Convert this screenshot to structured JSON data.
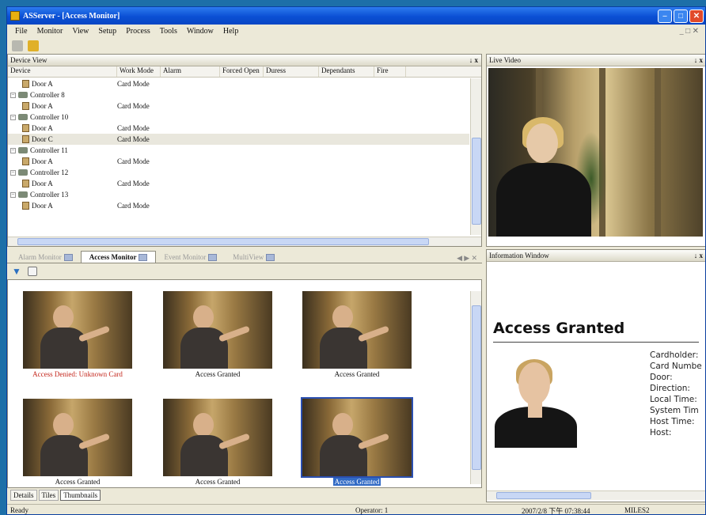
{
  "window": {
    "title": "ASServer - [Access Monitor]"
  },
  "menu": [
    "File",
    "Monitor",
    "View",
    "Setup",
    "Process",
    "Tools",
    "Window",
    "Help"
  ],
  "device_view": {
    "title": "Device View",
    "close": "x",
    "columns": [
      "Device",
      "Work Mode",
      "Alarm",
      "Forced Open",
      "Duress",
      "Dependants",
      "Fire"
    ],
    "rows": [
      {
        "name": "Door A",
        "mode": "Card Mode",
        "level": "door"
      },
      {
        "name": "Controller 8",
        "mode": "",
        "level": "controller"
      },
      {
        "name": "Door A",
        "mode": "Card Mode",
        "level": "door"
      },
      {
        "name": "Controller 10",
        "mode": "",
        "level": "controller"
      },
      {
        "name": "Door A",
        "mode": "Card Mode",
        "level": "door"
      },
      {
        "name": "Door C",
        "mode": "Card Mode",
        "level": "door"
      },
      {
        "name": "Controller 11",
        "mode": "",
        "level": "controller"
      },
      {
        "name": "Door A",
        "mode": "Card Mode",
        "level": "door"
      },
      {
        "name": "Controller 12",
        "mode": "",
        "level": "controller"
      },
      {
        "name": "Door A",
        "mode": "Card Mode",
        "level": "door"
      },
      {
        "name": "Controller 13",
        "mode": "",
        "level": "controller"
      },
      {
        "name": "Door A",
        "mode": "Card Mode",
        "level": "door"
      }
    ]
  },
  "live_video": {
    "title": "Live Video",
    "close": "x"
  },
  "tabs": [
    {
      "label": "Alarm Monitor",
      "active": false
    },
    {
      "label": "Access Monitor",
      "active": true
    },
    {
      "label": "Event Monitor",
      "active": false
    },
    {
      "label": "MultiView",
      "active": false
    }
  ],
  "thumbnails": [
    {
      "caption": "Access Denied: Unknown Card",
      "denied": true
    },
    {
      "caption": "Access Granted",
      "denied": false
    },
    {
      "caption": "Access Granted",
      "denied": false
    },
    {
      "caption": "Access Granted",
      "denied": false
    },
    {
      "caption": "Access Granted",
      "denied": false
    },
    {
      "caption": "Access Granted",
      "denied": false,
      "selected": true
    }
  ],
  "bottom_tabs": [
    "Details",
    "Tiles",
    "Thumbnails"
  ],
  "info_window": {
    "title": "Information Window",
    "close": "x",
    "heading": "Access Granted",
    "fields": [
      "Cardholder:",
      "Card Numbe",
      "Door:",
      "Direction:",
      "Local Time:",
      "System Tim",
      "Host Time:",
      "Host:"
    ]
  },
  "status": {
    "left": "Ready",
    "operator": "Operator: 1",
    "time": "2007/2/8 下午 07:38:44",
    "right": "MILES2"
  }
}
